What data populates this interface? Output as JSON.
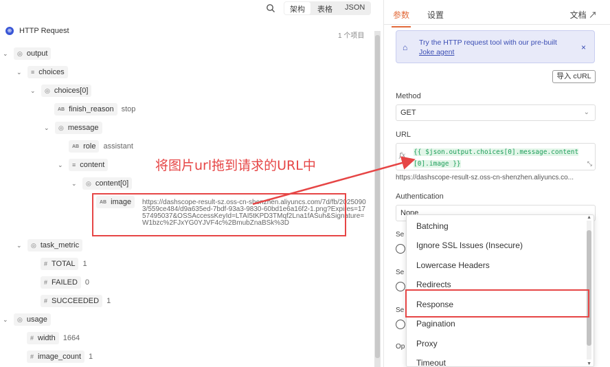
{
  "view_tabs": [
    "架构",
    "表格",
    "JSON"
  ],
  "tree": {
    "root_label": "HTTP Request",
    "item_count": "1 个项目",
    "nodes": {
      "output": "output",
      "choices": "choices",
      "choices0": "choices[0]",
      "finish_reason": "finish_reason",
      "finish_reason_val": "stop",
      "message": "message",
      "role": "role",
      "role_val": "assistant",
      "content": "content",
      "content0": "content[0]",
      "image": "image",
      "image_val": "https://dashscope-result-sz.oss-cn-shenzhen.aliyuncs.com/7d/fb/20250903/559ce484/d9a635ed-7bdf-93a3-9830-60bd1e6a16f2-1.png?Expires=1757495037&OSSAccessKeyId=LTAI5tKPD3TMqf2Lna1fASuh&Signature=W1bzc%2FJxYG0YJVF4c%2BmubZnaBSk%3D",
      "task_metric": "task_metric",
      "total": "TOTAL",
      "total_val": "1",
      "failed": "FAILED",
      "failed_val": "0",
      "succeeded": "SUCCEEDED",
      "succeeded_val": "1",
      "usage": "usage",
      "width": "width",
      "width_val": "1664",
      "image_count": "image_count",
      "image_count_val": "1"
    }
  },
  "annotation": "将图片url拖到请求的URL中",
  "right": {
    "tabs": [
      "参数",
      "设置"
    ],
    "docs": "文档",
    "banner_text": "Try the HTTP request tool with our pre-built",
    "banner_link": "Joke agent",
    "import_curl": "导入 cURL",
    "method_label": "Method",
    "method_value": "GET",
    "url_label": "URL",
    "url_expr_1": "{{ $json.output.choices[0].message.content",
    "url_expr_2": "[0].image }}",
    "url_preview": "https://dashscope-result-sz.oss-cn-shenzhen.aliyuncs.co...",
    "auth_label": "Authentication",
    "auth_value": "None",
    "stub_se1": "Se",
    "stub_se2": "Se",
    "stub_se3": "Se",
    "stub_op": "Op"
  },
  "dropdown": {
    "items": [
      "Batching",
      "Ignore SSL Issues (Insecure)",
      "Lowercase Headers",
      "Redirects",
      "Response",
      "Pagination",
      "Proxy",
      "Timeout"
    ],
    "highlighted": "Response"
  },
  "colors": {
    "accent": "#e26a3a",
    "annotation_red": "#e64545",
    "expression_green": "#1e9e5a",
    "banner_blue": "#3a4db3"
  }
}
